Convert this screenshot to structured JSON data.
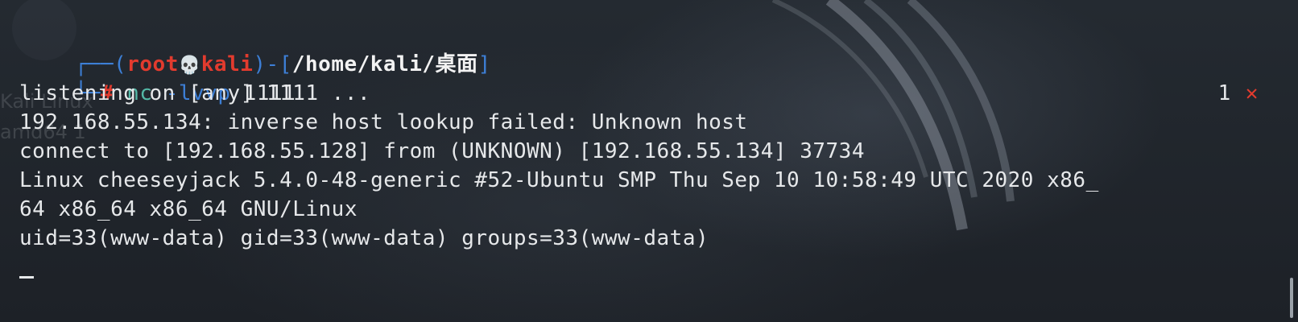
{
  "prompt": {
    "open_paren": "┌──(",
    "user": "root",
    "skull": "💀",
    "host": "kali",
    "mid": ")-[",
    "path": "/home/kali/桌面",
    "close": "]",
    "corner": "└─",
    "hash": "#"
  },
  "command": {
    "name": "nc",
    "option": "-lvvp",
    "arg": "1111"
  },
  "status": {
    "exit_code": "1",
    "error_mark": "✕"
  },
  "output": [
    "listening on [any] 1111 ...",
    "192.168.55.134: inverse host lookup failed: Unknown host",
    "connect to [192.168.55.128] from (UNKNOWN) [192.168.55.134] 37734",
    "Linux cheeseyjack 5.4.0-48-generic #52-Ubuntu SMP Thu Sep 10 10:58:49 UTC 2020 x86_",
    "64 x86_64 x86_64 GNU/Linux",
    "uid=33(www-data) gid=33(www-data) groups=33(www-data)"
  ],
  "background": {
    "watermark_line1": "Kali Linux",
    "watermark_line2": "amd64 1"
  },
  "colors": {
    "background": "#1e2228",
    "prompt_box": "#3d7fd6",
    "root_red": "#e23b2e",
    "command_teal": "#53b8a6",
    "text": "#e6e8ea"
  }
}
